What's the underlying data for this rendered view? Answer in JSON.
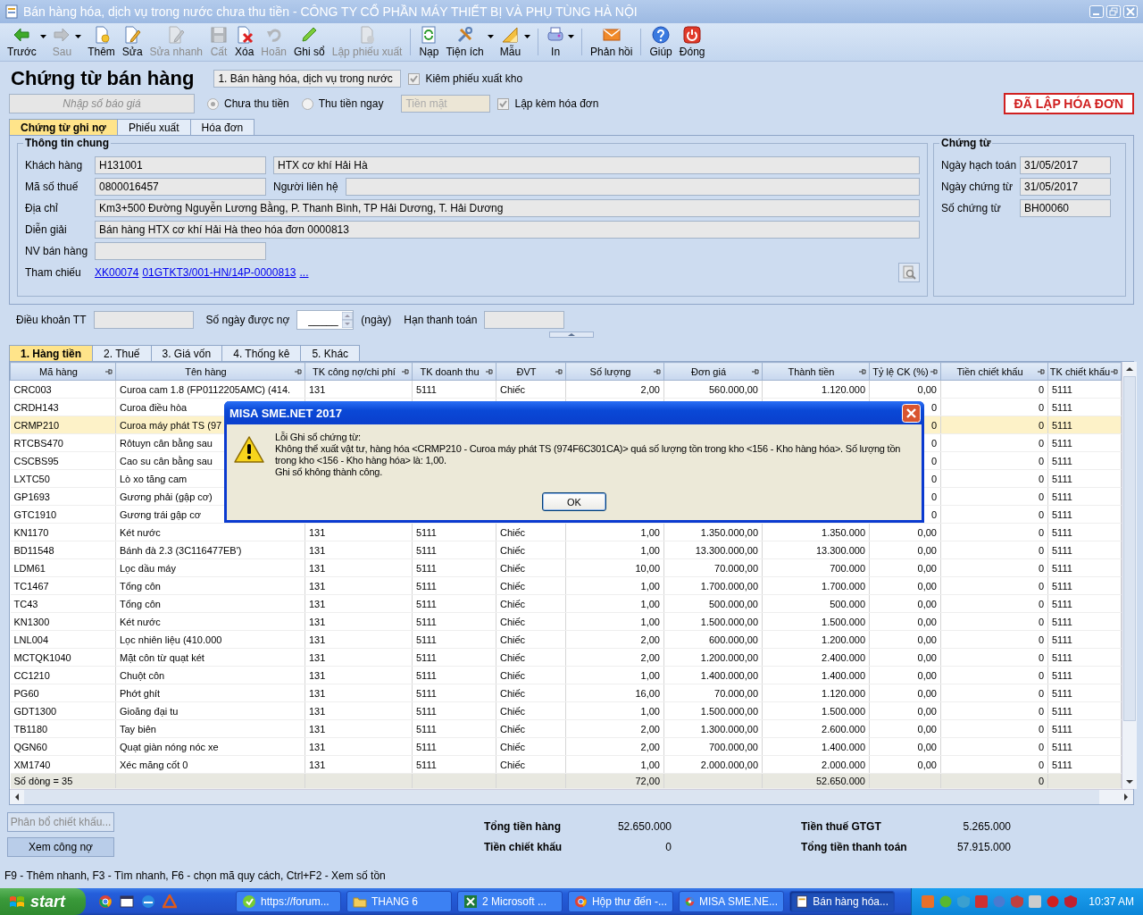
{
  "window": {
    "title": "Bán hàng hóa, dịch vụ trong nước chưa thu tiền - CÔNG TY CỔ PHẦN MÁY THIẾT BỊ VÀ PHỤ TÙNG HÀ NỘI"
  },
  "toolbar": [
    [
      {
        "label": "Trước",
        "disabled": false,
        "dropdown": true
      },
      {
        "label": "Sau",
        "disabled": true,
        "dropdown": true
      },
      {
        "label": "Thêm",
        "disabled": false,
        "dropdown": false
      },
      {
        "label": "Sửa",
        "disabled": false,
        "dropdown": false
      },
      {
        "label": "Sửa nhanh",
        "disabled": true,
        "dropdown": false
      },
      {
        "label": "Cất",
        "disabled": true,
        "dropdown": false
      },
      {
        "label": "Xóa",
        "disabled": false,
        "dropdown": false
      },
      {
        "label": "Hoãn",
        "disabled": true,
        "dropdown": false
      },
      {
        "label": "Ghi sổ",
        "disabled": false,
        "dropdown": false
      },
      {
        "label": "Lập phiếu xuất",
        "disabled": true,
        "dropdown": false
      }
    ],
    [
      {
        "label": "Nạp",
        "disabled": false,
        "dropdown": false
      },
      {
        "label": "Tiện ích",
        "disabled": false,
        "dropdown": true
      },
      {
        "label": "Mẫu",
        "disabled": false,
        "dropdown": true
      }
    ],
    [
      {
        "label": "In",
        "disabled": false,
        "dropdown": true
      }
    ],
    [
      {
        "label": "Phản hồi",
        "disabled": false,
        "dropdown": false
      }
    ],
    [
      {
        "label": "Giúp",
        "disabled": false,
        "dropdown": false
      },
      {
        "label": "Đóng",
        "disabled": false,
        "dropdown": false
      }
    ]
  ],
  "form": {
    "title": "Chứng từ bán hàng",
    "voucher_type": "1. Bán hàng hóa, dịch vụ trong nước",
    "export_check": {
      "label": "Kiêm phiếu xuất kho",
      "checked": true,
      "disabled": true
    },
    "quote_field": {
      "placeholder": "Nhập số báo giá"
    },
    "payment_options": [
      {
        "label": "Chưa thu tiền",
        "selected": true,
        "disabled": true
      },
      {
        "label": "Thu tiền ngay",
        "selected": false,
        "disabled": true
      }
    ],
    "payment_method": {
      "value": "Tiền mặt",
      "disabled": true
    },
    "invoice_check": {
      "label": "Lập kèm hóa đơn",
      "checked": true,
      "disabled": true
    },
    "status_badge": "ĐÃ LẬP HÓA ĐƠN"
  },
  "doc_tabs": [
    {
      "label": "Chứng từ ghi nợ",
      "selected": true
    },
    {
      "label": "Phiếu xuất",
      "selected": false
    },
    {
      "label": "Hóa đơn",
      "selected": false
    }
  ],
  "general": {
    "title": "Thông tin chung",
    "customer": {
      "label": "Khách hàng",
      "code": "H131001",
      "name": "HTX cơ khí Hải Hà"
    },
    "tax_code": {
      "label": "Mã số thuế",
      "value": "0800016457"
    },
    "contact": {
      "label": "Người liên hệ"
    },
    "address": {
      "label": "Địa chỉ",
      "value": "Km3+500 Đường Nguyễn Lương Bằng, P. Thanh Bình, TP Hải Dương, T. Hải Dương"
    },
    "description": {
      "label": "Diễn giải",
      "value": "Bán hàng HTX cơ khí Hải Hà theo hóa đơn 0000813"
    },
    "salesperson": {
      "label": "NV bán hàng"
    },
    "reference": {
      "label": "Tham chiếu",
      "links": [
        "XK00074",
        "01GTKT3/001-HN/14P-0000813",
        "..."
      ]
    }
  },
  "voucher": {
    "title": "Chứng từ",
    "fields": [
      {
        "label": "Ngày hạch toán",
        "value": "31/05/2017"
      },
      {
        "label": "Ngày chứng từ",
        "value": "31/05/2017"
      },
      {
        "label": "Số chứng từ",
        "value": "BH00060"
      }
    ]
  },
  "terms": {
    "payment_terms": {
      "label": "Điều khoản TT"
    },
    "credit_days": {
      "label": "Số ngày được nợ",
      "value": "_____",
      "unit": "(ngày)"
    },
    "due_date": {
      "label": "Hạn thanh toán"
    }
  },
  "grid_tabs": [
    {
      "label": "1. Hàng tiền",
      "selected": true
    },
    {
      "label": "2. Thuế",
      "selected": false
    },
    {
      "label": "3. Giá vốn",
      "selected": false
    },
    {
      "label": "4. Thống kê",
      "selected": false
    },
    {
      "label": "5. Khác",
      "selected": false
    }
  ],
  "table": {
    "columns": [
      {
        "label": "Mã hàng",
        "kind": "text"
      },
      {
        "label": "Tên hàng",
        "kind": "text"
      },
      {
        "label": "TK công nợ/chi phí",
        "kind": "text"
      },
      {
        "label": "TK doanh thu",
        "kind": "text"
      },
      {
        "label": "ĐVT",
        "kind": "text"
      },
      {
        "label": "Số lượng",
        "kind": "number"
      },
      {
        "label": "Đơn giá",
        "kind": "number"
      },
      {
        "label": "Thành tiền",
        "kind": "number"
      },
      {
        "label": "Tỷ lệ CK (%)",
        "kind": "number"
      },
      {
        "label": "Tiền chiết khấu",
        "kind": "number"
      },
      {
        "label": "TK chiết khấu",
        "kind": "text"
      }
    ],
    "rows": [
      {
        "selected": false,
        "cells": [
          "CRC003",
          "Curoa cam 1.8 (FP0112205AMC) (414.",
          "131",
          "5111",
          "Chiếc",
          "2,00",
          "560.000,00",
          "1.120.000",
          "0,00",
          "0",
          "5111"
        ]
      },
      {
        "selected": false,
        "cells": [
          "CRDH143",
          "Curoa điều hòa",
          null,
          null,
          null,
          null,
          null,
          null,
          "0",
          "0",
          "5111"
        ]
      },
      {
        "selected": true,
        "cells": [
          "CRMP210",
          "Curoa máy phát TS (97",
          null,
          null,
          null,
          null,
          null,
          null,
          "0",
          "0",
          "5111"
        ]
      },
      {
        "selected": false,
        "cells": [
          "RTCBS470",
          "Rôtuyn cân bằng sau",
          null,
          null,
          null,
          null,
          null,
          null,
          "0",
          "0",
          "5111"
        ]
      },
      {
        "selected": false,
        "cells": [
          "CSCBS95",
          "Cao su cân bằng sau",
          null,
          null,
          null,
          null,
          null,
          null,
          "0",
          "0",
          "5111"
        ]
      },
      {
        "selected": false,
        "cells": [
          "LXTC50",
          "Lò xo tăng cam",
          null,
          null,
          null,
          null,
          null,
          null,
          "0",
          "0",
          "5111"
        ]
      },
      {
        "selected": false,
        "cells": [
          "GP1693",
          "Gương phải (gập cơ)",
          null,
          null,
          null,
          null,
          null,
          null,
          "0",
          "0",
          "5111"
        ]
      },
      {
        "selected": false,
        "cells": [
          "GTC1910",
          "Gương trái gập cơ",
          null,
          null,
          null,
          null,
          null,
          null,
          "0",
          "0",
          "5111"
        ]
      },
      {
        "selected": false,
        "cells": [
          "KN1170",
          "Két nước",
          "131",
          "5111",
          "Chiếc",
          "1,00",
          "1.350.000,00",
          "1.350.000",
          "0,00",
          "0",
          "5111"
        ]
      },
      {
        "selected": false,
        "cells": [
          "BD11548",
          "Bánh đà 2.3 (3C116477EB')",
          "131",
          "5111",
          "Chiếc",
          "1,00",
          "13.300.000,00",
          "13.300.000",
          "0,00",
          "0",
          "5111"
        ]
      },
      {
        "selected": false,
        "cells": [
          "LDM61",
          "Lọc dầu máy",
          "131",
          "5111",
          "Chiếc",
          "10,00",
          "70.000,00",
          "700.000",
          "0,00",
          "0",
          "5111"
        ]
      },
      {
        "selected": false,
        "cells": [
          "TC1467",
          "Tổng côn",
          "131",
          "5111",
          "Chiếc",
          "1,00",
          "1.700.000,00",
          "1.700.000",
          "0,00",
          "0",
          "5111"
        ]
      },
      {
        "selected": false,
        "cells": [
          "TC43",
          "Tổng côn",
          "131",
          "5111",
          "Chiếc",
          "1,00",
          "500.000,00",
          "500.000",
          "0,00",
          "0",
          "5111"
        ]
      },
      {
        "selected": false,
        "cells": [
          "KN1300",
          "Két nước",
          "131",
          "5111",
          "Chiếc",
          "1,00",
          "1.500.000,00",
          "1.500.000",
          "0,00",
          "0",
          "5111"
        ]
      },
      {
        "selected": false,
        "cells": [
          "LNL004",
          "Lọc nhiên liệu (410.000",
          "131",
          "5111",
          "Chiếc",
          "2,00",
          "600.000,00",
          "1.200.000",
          "0,00",
          "0",
          "5111"
        ]
      },
      {
        "selected": false,
        "cells": [
          "MCTQK1040",
          "Mặt côn từ quạt két",
          "131",
          "5111",
          "Chiếc",
          "2,00",
          "1.200.000,00",
          "2.400.000",
          "0,00",
          "0",
          "5111"
        ]
      },
      {
        "selected": false,
        "cells": [
          "CC1210",
          "Chuột côn",
          "131",
          "5111",
          "Chiếc",
          "1,00",
          "1.400.000,00",
          "1.400.000",
          "0,00",
          "0",
          "5111"
        ]
      },
      {
        "selected": false,
        "cells": [
          "PG60",
          "Phớt ghít",
          "131",
          "5111",
          "Chiếc",
          "16,00",
          "70.000,00",
          "1.120.000",
          "0,00",
          "0",
          "5111"
        ]
      },
      {
        "selected": false,
        "cells": [
          "GDT1300",
          "Gioăng đại tu",
          "131",
          "5111",
          "Chiếc",
          "1,00",
          "1.500.000,00",
          "1.500.000",
          "0,00",
          "0",
          "5111"
        ]
      },
      {
        "selected": false,
        "cells": [
          "TB1180",
          "Tay biên",
          "131",
          "5111",
          "Chiếc",
          "2,00",
          "1.300.000,00",
          "2.600.000",
          "0,00",
          "0",
          "5111"
        ]
      },
      {
        "selected": false,
        "cells": [
          "QGN60",
          "Quạt giàn nóng nóc xe",
          "131",
          "5111",
          "Chiếc",
          "2,00",
          "700.000,00",
          "1.400.000",
          "0,00",
          "0",
          "5111"
        ]
      },
      {
        "selected": false,
        "cells": [
          "XM1740",
          "Xéc măng cốt 0",
          "131",
          "5111",
          "Chiếc",
          "1,00",
          "2.000.000,00",
          "2.000.000",
          "0,00",
          "0",
          "5111"
        ]
      }
    ],
    "footer": {
      "row_count": "Số dòng = 35",
      "quantity_total": "72,00",
      "amount_total": "52.650.000",
      "discount_total": "0"
    }
  },
  "dialog": {
    "title": "MISA SME.NET 2017",
    "lines": [
      "Lỗi Ghi sổ chứng từ:",
      "Không thể xuất vật tư, hàng hóa <CRMP210 - Curoa máy phát TS (974F6C301CA)> quá số lượng tồn trong kho <156 - Kho hàng hóa>. Số lượng tồn trong kho <156 - Kho hàng hóa> là: 1,00.",
      "Ghi sổ không thành công."
    ],
    "button": "OK"
  },
  "bottom_buttons": [
    {
      "label": "Phân bổ chiết khấu...",
      "disabled": true
    },
    {
      "label": "Xem công nợ",
      "disabled": false
    }
  ],
  "totals": [
    {
      "label": "Tổng tiền hàng",
      "value": "52.650.000"
    },
    {
      "label": "Tiền thuế GTGT",
      "value": "5.265.000"
    },
    {
      "label": "Tiền chiết khấu",
      "value": "0"
    },
    {
      "label": "Tổng tiền thanh toán",
      "value": "57.915.000"
    }
  ],
  "hint": "F9 - Thêm nhanh, F3 - Tìm nhanh, F6 - chọn mã quy cách, Ctrl+F2 - Xem số tồn",
  "taskbar": {
    "start": "start",
    "tasks": [
      {
        "label": "https://forum...",
        "selected": false
      },
      {
        "label": "THANG 6",
        "selected": false
      },
      {
        "label": "2 Microsoft ...",
        "selected": false
      },
      {
        "label": "Hộp thư đến -...",
        "selected": false
      },
      {
        "label": "MISA SME.NE...",
        "selected": false
      },
      {
        "label": "Bán hàng hóa...",
        "selected": true
      }
    ],
    "clock": "10:37 AM"
  }
}
